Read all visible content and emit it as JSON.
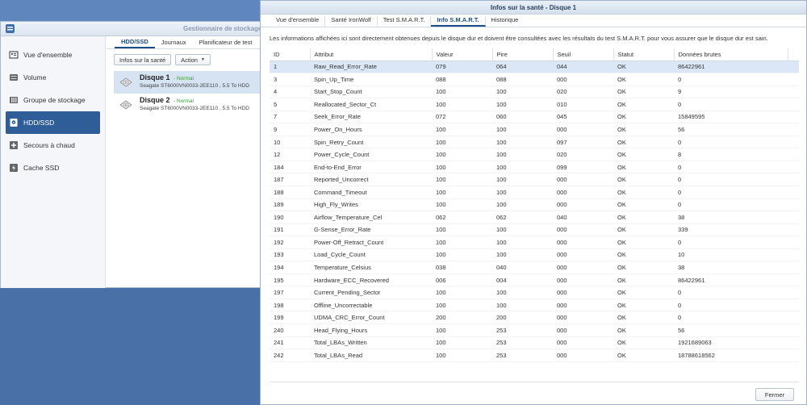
{
  "storage_manager": {
    "title": "Gestionnaire de stockage",
    "sidebar": [
      {
        "label": "Vue d'ensemble",
        "icon": "overview-icon"
      },
      {
        "label": "Volume",
        "icon": "volume-icon"
      },
      {
        "label": "Groupe de stockage",
        "icon": "storage-pool-icon"
      },
      {
        "label": "HDD/SSD",
        "icon": "hdd-icon",
        "active": true
      },
      {
        "label": "Secours à chaud",
        "icon": "hot-spare-icon"
      },
      {
        "label": "Cache SSD",
        "icon": "ssd-cache-icon"
      }
    ],
    "tabs": [
      "HDD/SSD",
      "Journaux",
      "Planificateur de test"
    ],
    "toolbar": {
      "health_info": "Infos sur la santé",
      "action": "Action"
    },
    "disks": [
      {
        "name": "Disque 1",
        "status": "- Normal",
        "model": "Seagate ST6000VN0033-2EE110 , 5.5 To HDD"
      },
      {
        "name": "Disque 2",
        "status": "- Normal",
        "model": "Seagate ST6000VN0033-2EE110 , 5.5 To HDD"
      }
    ]
  },
  "dialog": {
    "title": "Infos sur la santé - Disque 1",
    "tabs": [
      "Vue d'ensemble",
      "Santé IronWolf",
      "Test S.M.A.R.T.",
      "Info S.M.A.R.T.",
      "Historique"
    ],
    "active_tab": 3,
    "description": "Les informations affichées ici sont directement obtenues depuis le disque dur et doivent être consultées avec les résultats du test S.M.A.R.T. pour vous assurer que le disque dur est sain.",
    "columns": [
      "ID",
      "Attribut",
      "Valeur",
      "Pire",
      "Seuil",
      "Statut",
      "Données brutes"
    ],
    "rows": [
      [
        "1",
        "Raw_Read_Error_Rate",
        "079",
        "064",
        "044",
        "OK",
        "86422961"
      ],
      [
        "3",
        "Spin_Up_Time",
        "088",
        "088",
        "000",
        "OK",
        "0"
      ],
      [
        "4",
        "Start_Stop_Count",
        "100",
        "100",
        "020",
        "OK",
        "9"
      ],
      [
        "5",
        "Reallocated_Sector_Ct",
        "100",
        "100",
        "010",
        "OK",
        "0"
      ],
      [
        "7",
        "Seek_Error_Rate",
        "072",
        "060",
        "045",
        "OK",
        "15849595"
      ],
      [
        "9",
        "Power_On_Hours",
        "100",
        "100",
        "000",
        "OK",
        "56"
      ],
      [
        "10",
        "Spin_Retry_Count",
        "100",
        "100",
        "097",
        "OK",
        "0"
      ],
      [
        "12",
        "Power_Cycle_Count",
        "100",
        "100",
        "020",
        "OK",
        "8"
      ],
      [
        "184",
        "End-to-End_Error",
        "100",
        "100",
        "099",
        "OK",
        "0"
      ],
      [
        "187",
        "Reported_Uncorrect",
        "100",
        "100",
        "000",
        "OK",
        "0"
      ],
      [
        "188",
        "Command_Timeout",
        "100",
        "100",
        "000",
        "OK",
        "0"
      ],
      [
        "189",
        "High_Fly_Writes",
        "100",
        "100",
        "000",
        "OK",
        "0"
      ],
      [
        "190",
        "Airflow_Temperature_Cel",
        "062",
        "062",
        "040",
        "OK",
        "38"
      ],
      [
        "191",
        "G-Sense_Error_Rate",
        "100",
        "100",
        "000",
        "OK",
        "339"
      ],
      [
        "192",
        "Power-Off_Retract_Count",
        "100",
        "100",
        "000",
        "OK",
        "0"
      ],
      [
        "193",
        "Load_Cycle_Count",
        "100",
        "100",
        "000",
        "OK",
        "10"
      ],
      [
        "194",
        "Temperature_Celsius",
        "038",
        "040",
        "000",
        "OK",
        "38"
      ],
      [
        "195",
        "Hardware_ECC_Recovered",
        "006",
        "004",
        "000",
        "OK",
        "86422961"
      ],
      [
        "197",
        "Current_Pending_Sector",
        "100",
        "100",
        "000",
        "OK",
        "0"
      ],
      [
        "198",
        "Offline_Uncorrectable",
        "100",
        "100",
        "000",
        "OK",
        "0"
      ],
      [
        "199",
        "UDMA_CRC_Error_Count",
        "200",
        "200",
        "000",
        "OK",
        "0"
      ],
      [
        "240",
        "Head_Flying_Hours",
        "100",
        "253",
        "000",
        "OK",
        "56"
      ],
      [
        "241",
        "Total_LBAs_Written",
        "100",
        "253",
        "000",
        "OK",
        "1921689063"
      ],
      [
        "242",
        "Total_LBAs_Read",
        "100",
        "253",
        "000",
        "OK",
        "18788618562"
      ]
    ],
    "selected_row": 0,
    "close_label": "Fermer"
  },
  "colors": {
    "accent": "#2f5d98",
    "desktop": "#4a70a8",
    "status_normal": "#3a9a3a",
    "selection": "#dbe7f6"
  }
}
